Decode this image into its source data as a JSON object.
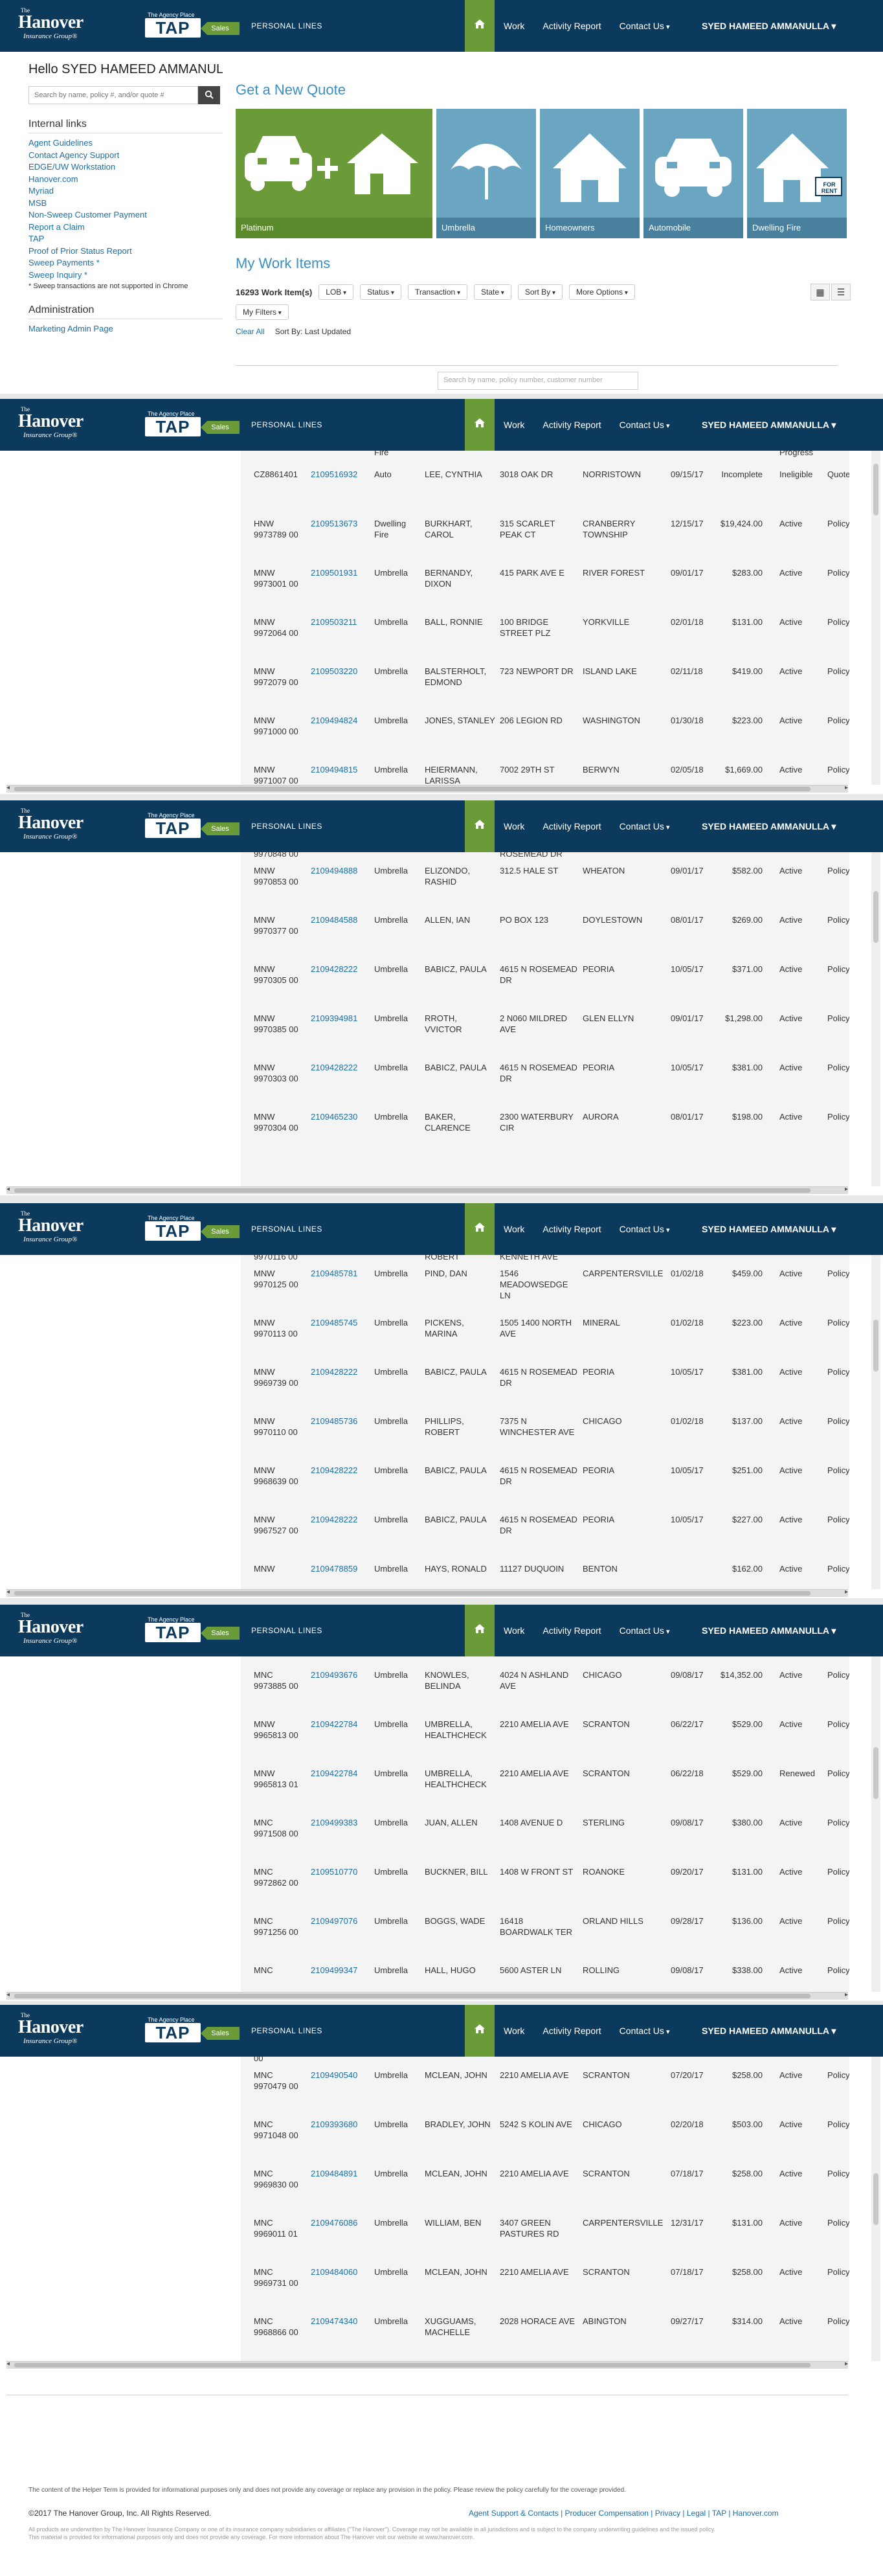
{
  "header": {
    "logo_small": "The",
    "logo_main": "Hanover",
    "logo_sub": "Insurance Group®",
    "tap_small": "The Agency Place",
    "tap_big": "TAP",
    "tap_sales": "Sales",
    "personal_lines": "PERSONAL LINES",
    "nav": [
      "Work",
      "Activity Report",
      "Contact Us"
    ],
    "user": "SYED HAMEED AMMANULLA"
  },
  "sidebar": {
    "greeting": "Hello SYED HAMEED AMMANULLA!",
    "search_placeholder": "Search by name, policy #, and/or quote #",
    "internal_links_title": "Internal links",
    "links": [
      "Agent Guidelines",
      "Contact Agency Support",
      "EDGE/UW Workstation",
      "Hanover.com",
      "Myriad",
      "MSB",
      "Non-Sweep Customer Payment",
      "Report a Claim",
      "TAP",
      "Proof of Prior Status Report",
      "Sweep Payments *",
      "Sweep Inquiry *"
    ],
    "note": "* Sweep transactions are not supported in Chrome",
    "admin_title": "Administration",
    "admin_links": [
      "Marketing Admin Page"
    ]
  },
  "quote": {
    "title": "Get a New Quote",
    "tiles": [
      "Platinum",
      "Umbrella",
      "Homeowners",
      "Automobile",
      "Dwelling Fire"
    ],
    "for_rent": "FOR RENT"
  },
  "work": {
    "title": "My Work Items",
    "count": "16293 Work Item(s)",
    "filters": [
      "LOB",
      "Status",
      "Transaction",
      "State",
      "Sort By",
      "More Options"
    ],
    "my_filters": "My Filters",
    "clear_all": "Clear All",
    "sort_by": "Sort By: Last Updated",
    "table_search_placeholder": "Search by name, policy number, customer number"
  },
  "sections": [
    {
      "top_partial": [
        "",
        "",
        "Fire",
        "",
        "",
        "",
        "",
        "",
        "Progress",
        ""
      ],
      "rows": [
        [
          "CZ8861401",
          "2109516932",
          "Auto",
          "LEE, CYNTHIA",
          "3018 OAK DR",
          "NORRISTOWN",
          "09/15/17",
          "Incomplete",
          "Ineligible",
          "Quote"
        ],
        [
          "HNW 9973789 00",
          "2109513673",
          "Dwelling Fire",
          "BURKHART, CAROL",
          "315 SCARLET PEAK CT",
          "CRANBERRY TOWNSHIP",
          "12/15/17",
          "$19,424.00",
          "Active",
          "Policy"
        ],
        [
          "MNW 9973001 00",
          "2109501931",
          "Umbrella",
          "BERNANDY, DIXON",
          "415 PARK AVE E",
          "RIVER FOREST",
          "09/01/17",
          "$283.00",
          "Active",
          "Policy"
        ],
        [
          "MNW 9972064 00",
          "2109503211",
          "Umbrella",
          "BALL, RONNIE",
          "100 BRIDGE STREET PLZ",
          "YORKVILLE",
          "02/01/18",
          "$131.00",
          "Active",
          "Policy"
        ],
        [
          "MNW 9972079 00",
          "2109503220",
          "Umbrella",
          "BALSTERHOLT, EDMOND",
          "723 NEWPORT DR",
          "ISLAND LAKE",
          "02/11/18",
          "$419.00",
          "Active",
          "Policy"
        ],
        [
          "MNW 9971000 00",
          "2109494824",
          "Umbrella",
          "JONES, STANLEY",
          "206 LEGION RD",
          "WASHINGTON",
          "01/30/18",
          "$223.00",
          "Active",
          "Policy"
        ],
        [
          "MNW 9971007 00",
          "2109494815",
          "Umbrella",
          "HEIERMANN, LARISSA",
          "7002 29TH ST",
          "BERWYN",
          "02/05/18",
          "$1,669.00",
          "Active",
          "Policy"
        ]
      ]
    },
    {
      "top_partial": [
        "9970848 00",
        "",
        "",
        "",
        "ROSEMEAD DR",
        "",
        "",
        "",
        "",
        ""
      ],
      "rows": [
        [
          "MNW 9970853 00",
          "2109494888",
          "Umbrella",
          "ELIZONDO, RASHID",
          "312.5 HALE ST",
          "WHEATON",
          "09/01/17",
          "$582.00",
          "Active",
          "Policy"
        ],
        [
          "MNW 9970377 00",
          "2109484588",
          "Umbrella",
          "ALLEN, IAN",
          "PO BOX 123",
          "DOYLESTOWN",
          "08/01/17",
          "$269.00",
          "Active",
          "Policy"
        ],
        [
          "MNW 9970305 00",
          "2109428222",
          "Umbrella",
          "BABICZ, PAULA",
          "4615 N ROSEMEAD DR",
          "PEORIA",
          "10/05/17",
          "$371.00",
          "Active",
          "Policy"
        ],
        [
          "MNW 9970385 00",
          "2109394981",
          "Umbrella",
          "RROTH, VVICTOR",
          "2 N060 MILDRED AVE",
          "GLEN ELLYN",
          "09/01/17",
          "$1,298.00",
          "Active",
          "Policy"
        ],
        [
          "MNW 9970303 00",
          "2109428222",
          "Umbrella",
          "BABICZ, PAULA",
          "4615 N ROSEMEAD DR",
          "PEORIA",
          "10/05/17",
          "$381.00",
          "Active",
          "Policy"
        ],
        [
          "MNW 9970304 00",
          "2109465230",
          "Umbrella",
          "BAKER, CLARENCE",
          "2300 WATERBURY CIR",
          "AURORA",
          "08/01/17",
          "$198.00",
          "Active",
          "Policy"
        ]
      ]
    },
    {
      "top_partial": [
        "9970116 00",
        "",
        "",
        "ROBERT",
        "KENNETH AVE",
        "",
        "",
        "",
        "",
        ""
      ],
      "rows": [
        [
          "MNW 9970125 00",
          "2109485781",
          "Umbrella",
          "PIND, DAN",
          "1546 MEADOWSEDGE LN",
          "CARPENTERSVILLE",
          "01/02/18",
          "$459.00",
          "Active",
          "Policy"
        ],
        [
          "MNW 9970113 00",
          "2109485745",
          "Umbrella",
          "PICKENS, MARINA",
          "1505 1400 NORTH AVE",
          "MINERAL",
          "01/02/18",
          "$223.00",
          "Active",
          "Policy"
        ],
        [
          "MNW 9969739 00",
          "2109428222",
          "Umbrella",
          "BABICZ, PAULA",
          "4615 N ROSEMEAD DR",
          "PEORIA",
          "10/05/17",
          "$381.00",
          "Active",
          "Policy"
        ],
        [
          "MNW 9970110 00",
          "2109485736",
          "Umbrella",
          "PHILLIPS, ROBERT",
          "7375 N WINCHESTER AVE",
          "CHICAGO",
          "01/02/18",
          "$137.00",
          "Active",
          "Policy"
        ],
        [
          "MNW 9968639 00",
          "2109428222",
          "Umbrella",
          "BABICZ, PAULA",
          "4615 N ROSEMEAD DR",
          "PEORIA",
          "10/05/17",
          "$251.00",
          "Active",
          "Policy"
        ],
        [
          "MNW 9967527 00",
          "2109428222",
          "Umbrella",
          "BABICZ, PAULA",
          "4615 N ROSEMEAD DR",
          "PEORIA",
          "10/05/17",
          "$227.00",
          "Active",
          "Policy"
        ]
      ],
      "bottom_partial": [
        "MNW",
        "2109478859",
        "Umbrella",
        "HAYS, RONALD",
        "11127 DUQUOIN",
        "BENTON",
        "",
        "$162.00",
        "Active",
        "Policy"
      ]
    },
    {
      "top_partial": [
        "",
        "",
        "",
        "",
        "",
        "",
        "",
        "",
        "",
        ""
      ],
      "rows": [
        [
          "MNC 9973885 00",
          "2109493676",
          "Umbrella",
          "KNOWLES, BELINDA",
          "4024 N ASHLAND AVE",
          "CHICAGO",
          "09/08/17",
          "$14,352.00",
          "Active",
          "Policy"
        ],
        [
          "MNW 9965813 00",
          "2109422784",
          "Umbrella",
          "UMBRELLA, HEALTHCHECK",
          "2210 AMELIA AVE",
          "SCRANTON",
          "06/22/17",
          "$529.00",
          "Active",
          "Policy"
        ],
        [
          "MNW 9965813 01",
          "2109422784",
          "Umbrella",
          "UMBRELLA, HEALTHCHECK",
          "2210 AMELIA AVE",
          "SCRANTON",
          "06/22/18",
          "$529.00",
          "Renewed",
          "Policy"
        ],
        [
          "MNC 9971508 00",
          "2109499383",
          "Umbrella",
          "JUAN, ALLEN",
          "1408 AVENUE D",
          "STERLING",
          "09/08/17",
          "$380.00",
          "Active",
          "Policy"
        ],
        [
          "MNC 9972862 00",
          "2109510770",
          "Umbrella",
          "BUCKNER, BILL",
          "1408 W FRONT ST",
          "ROANOKE",
          "09/20/17",
          "$131.00",
          "Active",
          "Policy"
        ],
        [
          "MNC 9971256 00",
          "2109497076",
          "Umbrella",
          "BOGGS, WADE",
          "16418 BOARDWALK TER",
          "ORLAND HILLS",
          "09/28/17",
          "$136.00",
          "Active",
          "Policy"
        ]
      ],
      "bottom_partial": [
        "MNC",
        "2109499347",
        "Umbrella",
        "HALL, HUGO",
        "5600 ASTER LN",
        "ROLLING",
        "09/08/17",
        "$338.00",
        "Active",
        "Policy"
      ]
    },
    {
      "top_partial": [
        "00",
        "",
        "",
        "",
        "",
        "",
        "",
        "",
        "",
        ""
      ],
      "rows": [
        [
          "MNC 9970479 00",
          "2109490540",
          "Umbrella",
          "MCLEAN, JOHN",
          "2210 AMELIA AVE",
          "SCRANTON",
          "07/20/17",
          "$258.00",
          "Active",
          "Policy"
        ],
        [
          "MNC 9971048 00",
          "2109393680",
          "Umbrella",
          "BRADLEY, JOHN",
          "5242 S KOLIN AVE",
          "CHICAGO",
          "02/20/18",
          "$503.00",
          "Active",
          "Policy"
        ],
        [
          "MNC 9969830 00",
          "2109484891",
          "Umbrella",
          "MCLEAN, JOHN",
          "2210 AMELIA AVE",
          "SCRANTON",
          "07/18/17",
          "$258.00",
          "Active",
          "Policy"
        ],
        [
          "MNC 9969011 01",
          "2109476086",
          "Umbrella",
          "WILLIAM, BEN",
          "3407 GREEN PASTURES RD",
          "CARPENTERSVILLE",
          "12/31/17",
          "$131.00",
          "Active",
          "Policy"
        ],
        [
          "MNC 9969731 00",
          "2109484060",
          "Umbrella",
          "MCLEAN, JOHN",
          "2210 AMELIA AVE",
          "SCRANTON",
          "07/18/17",
          "$258.00",
          "Active",
          "Policy"
        ],
        [
          "MNC 9968866 00",
          "2109474340",
          "Umbrella",
          "XUGGUAMS, MACHELLE",
          "2028 HORACE AVE",
          "ABINGTON",
          "09/27/17",
          "$314.00",
          "Active",
          "Policy"
        ]
      ]
    }
  ],
  "footer": {
    "disclaimer": "The content of the Helper Term is provided for informational purposes only and does not provide any coverage or replace any provision in the policy. Please review the policy carefully for the coverage provided.",
    "copyright": "©2017 The Hanover Group, Inc. All Rights Reserved.",
    "links": "Agent Support & Contacts | Producer Compensation | Privacy | Legal | TAP | Hanover.com",
    "fine_print": "All products are underwritten by The Hanover Insurance Company or one of its insurance company subsidiaries or affiliates (\"The Hanover\"). Coverage may not be available in all jurisdictions and is subject to the company underwriting guidelines and the issued policy. This material is provided for informational purposes only and does not provide any coverage. For more information about The Hanover visit our website at www.hanover.com."
  }
}
